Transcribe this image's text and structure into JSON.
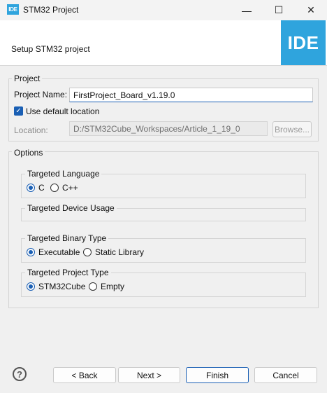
{
  "window": {
    "app_icon": "IDE",
    "title": "STM32 Project",
    "controls": {
      "minimize": "—",
      "maximize": "☐",
      "close": "✕"
    }
  },
  "header": {
    "title": "Setup STM32 project",
    "banner_text": "IDE"
  },
  "project": {
    "group_title": "Project",
    "name_label": "Project Name:",
    "name_value": "FirstProject_Board_v1.19.0",
    "use_default_label": "Use default location",
    "location_label": "Location:",
    "location_value": "D:/STM32Cube_Workspaces/Article_1_19_0",
    "browse_label": "Browse..."
  },
  "options": {
    "group_title": "Options",
    "language": {
      "title": "Targeted Language",
      "options": [
        "C",
        "C++"
      ],
      "selected": "C"
    },
    "device_usage": {
      "title": "Targeted Device Usage"
    },
    "binary": {
      "title": "Targeted Binary Type",
      "options": [
        "Executable",
        "Static Library"
      ],
      "selected": "Executable"
    },
    "project_type": {
      "title": "Targeted Project Type",
      "options": [
        "STM32Cube",
        "Empty"
      ],
      "selected": "STM32Cube"
    }
  },
  "footer": {
    "help": "?",
    "back_label": "< Back",
    "next_label": "Next >",
    "finish_label": "Finish",
    "cancel_label": "Cancel"
  },
  "colors": {
    "accent": "#1a5fb4",
    "brand": "#2fa4dd"
  }
}
